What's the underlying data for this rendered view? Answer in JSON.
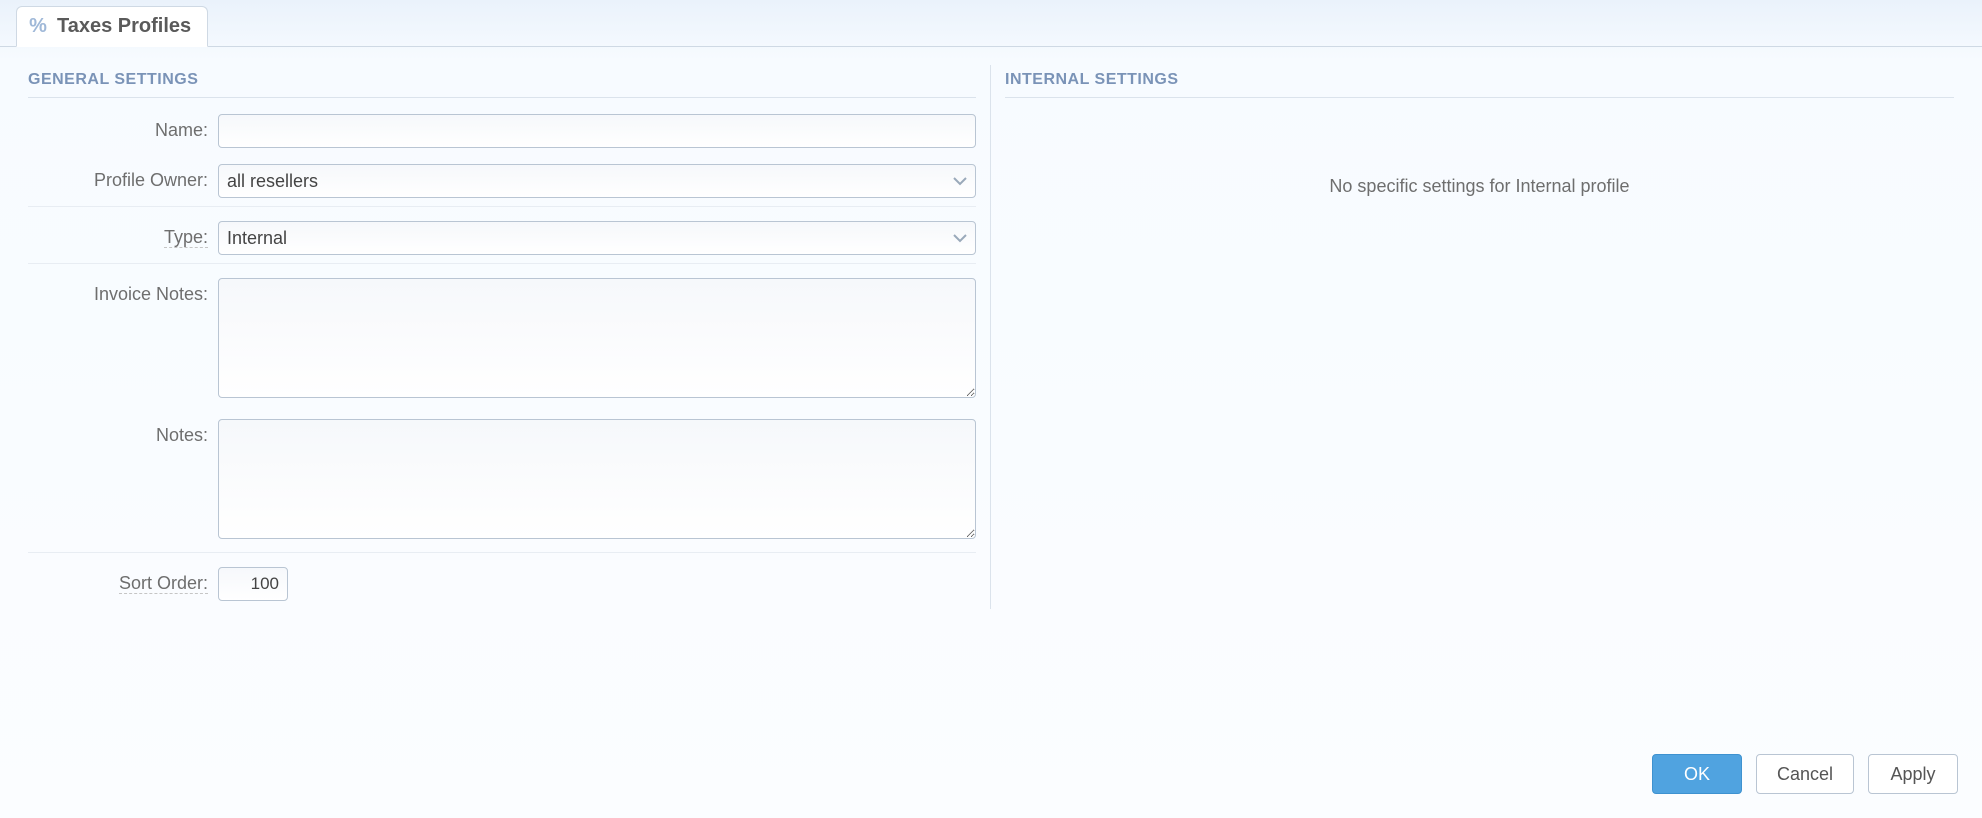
{
  "tab": {
    "icon": "%",
    "title": "Taxes Profiles"
  },
  "sections": {
    "general_title": "GENERAL SETTINGS",
    "internal_title": "INTERNAL SETTINGS"
  },
  "labels": {
    "name": "Name:",
    "profile_owner": "Profile Owner:",
    "type": "Type:",
    "invoice_notes": "Invoice Notes:",
    "notes": "Notes:",
    "sort_order": "Sort Order:"
  },
  "values": {
    "name": "",
    "profile_owner": "all resellers",
    "type": "Internal",
    "invoice_notes": "",
    "notes": "",
    "sort_order": "100"
  },
  "internal_message": "No specific settings for Internal profile",
  "buttons": {
    "ok": "OK",
    "cancel": "Cancel",
    "apply": "Apply"
  }
}
